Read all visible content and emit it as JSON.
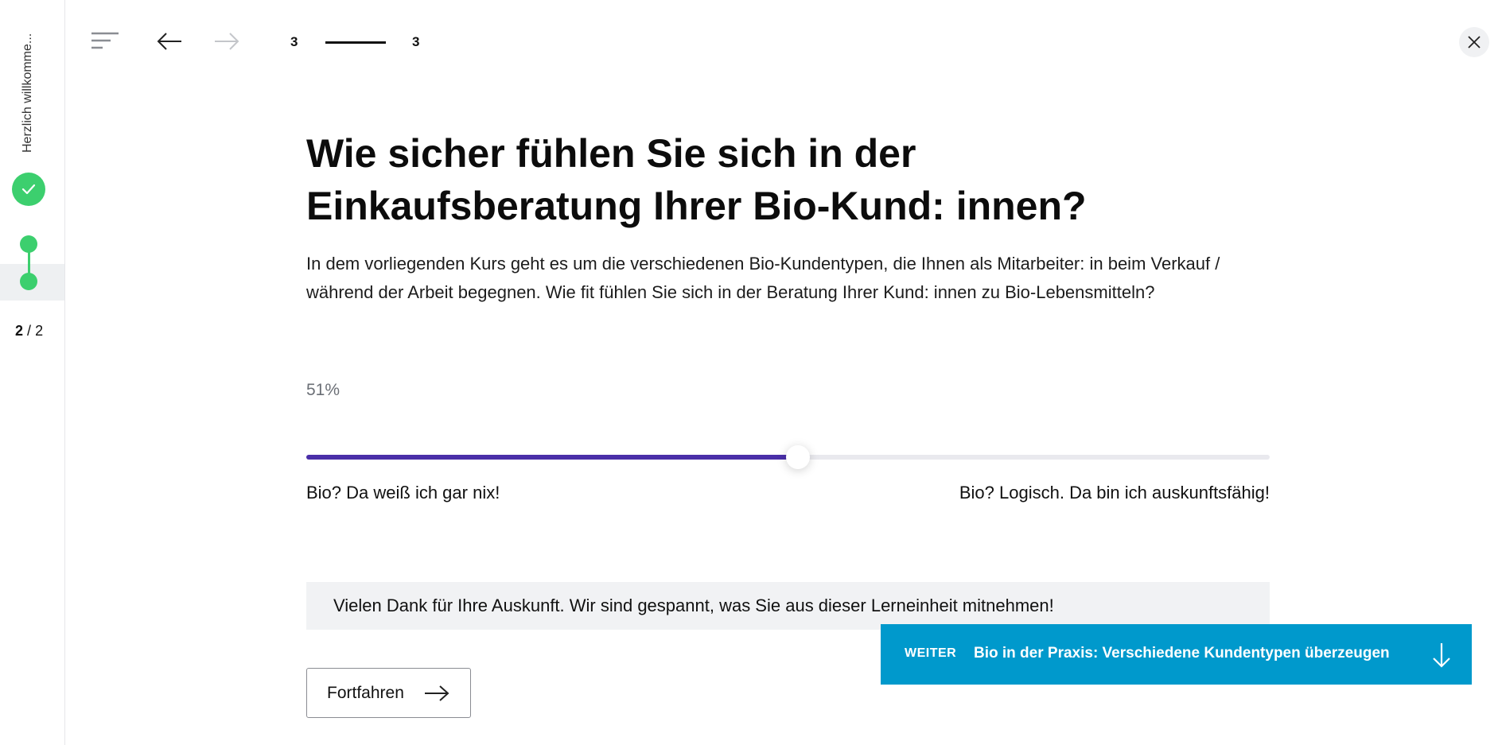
{
  "sidebar": {
    "title": "Herzlich willkomme...",
    "page_current": "2",
    "page_sep": "/",
    "page_total": "2"
  },
  "topbar": {
    "progress_current": "3",
    "progress_total": "3"
  },
  "question": {
    "heading": "Wie sicher fühlen Sie sich in der Einkaufsberatung Ihrer Bio-Kund: innen?",
    "intro": "In dem vorliegenden Kurs geht es um die verschiedenen Bio-Kundentypen, die Ihnen als Mitarbeiter: in beim Verkauf / während der Arbeit begegnen. Wie fit fühlen Sie sich in der Beratung Ihrer Kund: innen zu Bio-Lebensmitteln?"
  },
  "slider": {
    "value_label": "51%",
    "value_percent": 51,
    "min_label": "Bio? Da weiß ich gar nix!",
    "max_label": "Bio? Logisch. Da bin ich auskunftsfähig!"
  },
  "feedback": {
    "text": "Vielen Dank für Ihre Auskunft. Wir sind gespannt, was Sie aus dieser Lerneinheit mitnehmen!"
  },
  "continue_button": {
    "label": "Fortfahren"
  },
  "next_lesson": {
    "tag": "WEITER",
    "title": "Bio in der Praxis: Verschiedene Kundentypen überzeugen"
  },
  "colors": {
    "accent_green": "#3ccf6e",
    "slider_fill": "#4a2fa8",
    "banner_blue": "#0099cc"
  }
}
